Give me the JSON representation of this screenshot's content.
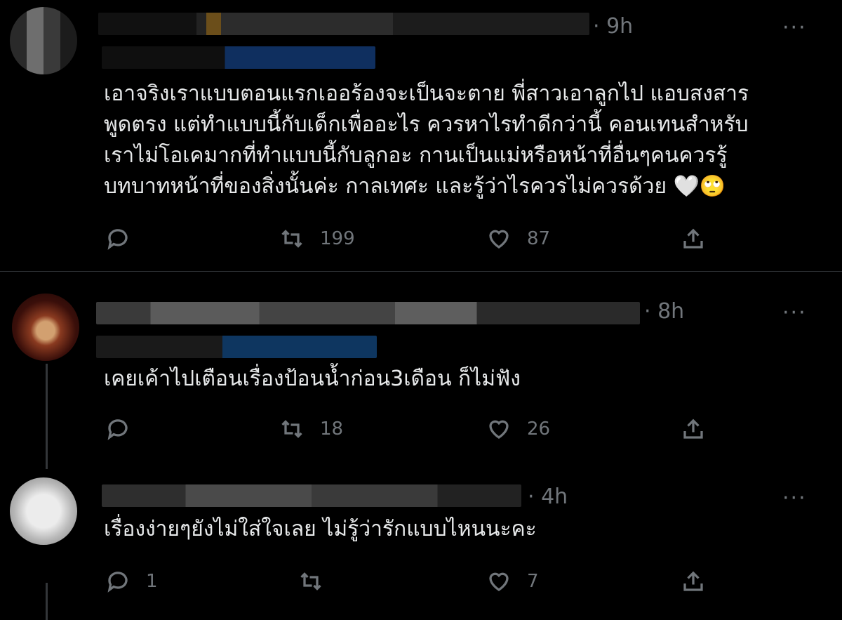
{
  "tweets": [
    {
      "time": "· 9h",
      "more": "···",
      "text": "เอาจริงเราแบบตอนแรกเออร้องจะเป็นจะตาย พี่สาวเอาลูกไป แอบสงสาร\nพูดตรง แต่ทำแบบนี้กับเด็กเพื่ออะไร ควรหาไรทำดีกว่านี้ คอนเทนสำหรับ\nเราไม่โอเคมากที่ทำแบบนี้กับลูกอะ กานเป็นแม่หรือหน้าที่อื่นๆคนควรรู้\nบทบาทหน้าที่ของสิ่งนั้นค่ะ กาลเทศะ และรู้ว่าไรควรไม่ควรด้วย 🤍🙄",
      "replies": "",
      "retweets": "199",
      "likes": "87"
    },
    {
      "time": "· 8h",
      "more": "···",
      "text": "เคยเค้าไปเตือนเรื่องป้อนน้ำก่อน3เดือน ก็ไม่ฟัง",
      "replies": "",
      "retweets": "18",
      "likes": "26"
    },
    {
      "time": "· 4h",
      "more": "···",
      "text": "เรื่องง่ายๆยังไม่ใส่ใจเลย ไม่รู้ว่ารักแบบไหนนะคะ",
      "replies": "1",
      "retweets": "",
      "likes": "7"
    }
  ],
  "icons": {
    "reply": "reply-icon",
    "retweet": "retweet-icon",
    "like": "heart-icon",
    "share": "share-icon"
  },
  "colors": {
    "background": "#000000",
    "text": "#e7e9ea",
    "muted": "#71767b"
  }
}
